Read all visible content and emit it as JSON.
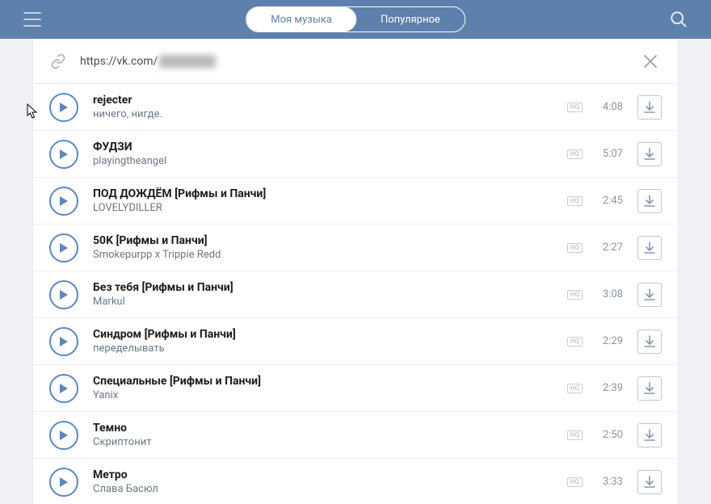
{
  "header": {
    "tabs": {
      "my_music": "Моя музыка",
      "popular": "Популярное"
    }
  },
  "urlbar": {
    "url": "https://vk.com/"
  },
  "hq_label": "HQ",
  "tracks": [
    {
      "title": "rejecter",
      "artist": "ничего, нигде.",
      "duration": "4:08"
    },
    {
      "title": "ФУДЗИ",
      "artist": "playingtheangel",
      "duration": "5:07"
    },
    {
      "title": "ПОД ДОЖДЁМ [Рифмы и Панчи]",
      "artist": "LOVELYDILLER",
      "duration": "2:45"
    },
    {
      "title": "50K [Рифмы и Панчи]",
      "artist": "Smokepurpp x Trippie Redd",
      "duration": "2:27"
    },
    {
      "title": "Без тебя [Рифмы и Панчи]",
      "artist": "Markul",
      "duration": "3:08"
    },
    {
      "title": "Синдром [Рифмы и Панчи]",
      "artist": "переделывать",
      "duration": "2:29"
    },
    {
      "title": "Специальные [Рифмы и Панчи]",
      "artist": "Yanix",
      "duration": "2:39"
    },
    {
      "title": "Темно",
      "artist": "Скриптонит",
      "duration": "2:50"
    },
    {
      "title": "Метро",
      "artist": "Слава Басюл",
      "duration": "3:33"
    }
  ]
}
